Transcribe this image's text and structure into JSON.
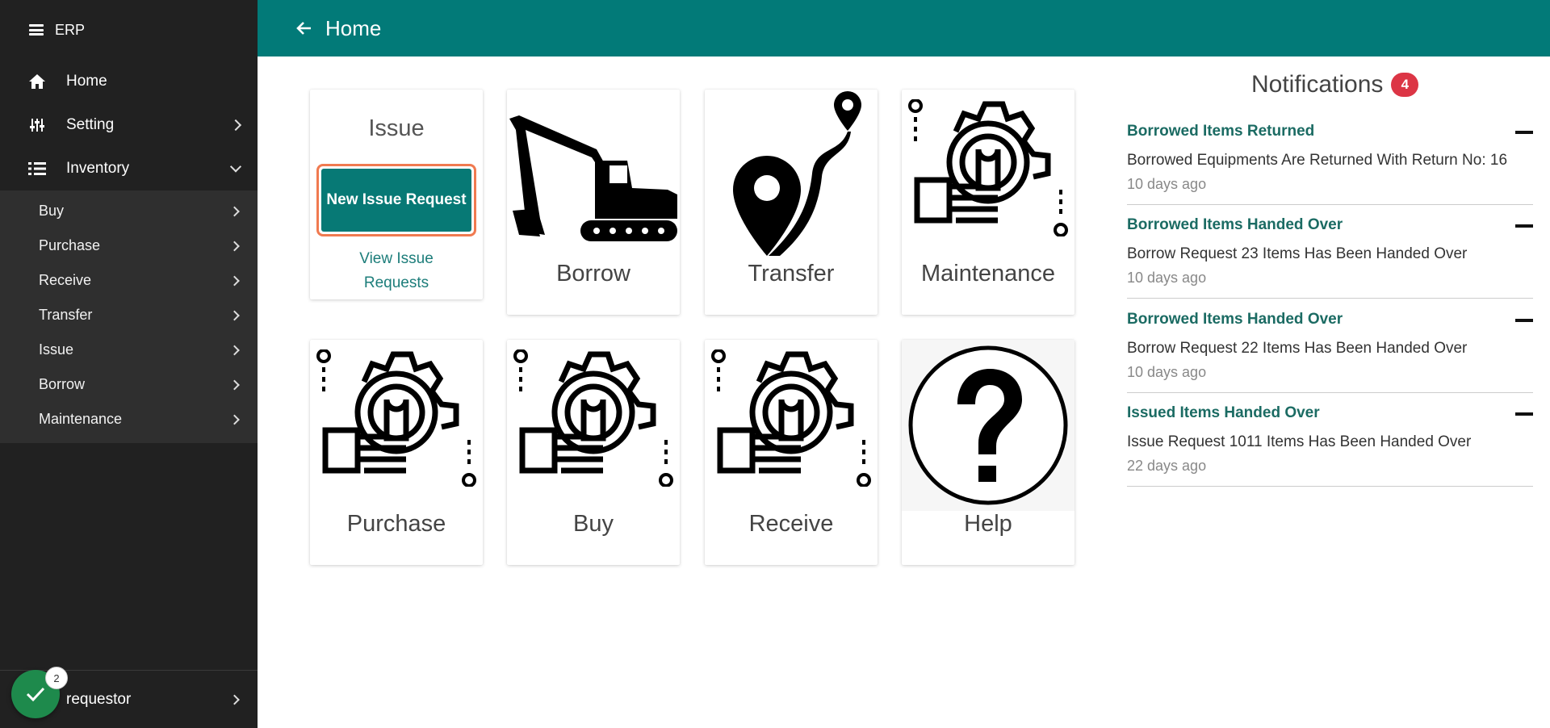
{
  "sidebar": {
    "brand": "ERP",
    "items": [
      {
        "label": "Home",
        "icon": "home-icon"
      },
      {
        "label": "Setting",
        "icon": "sliders-icon"
      },
      {
        "label": "Inventory",
        "icon": "list-icon"
      }
    ],
    "subitems": [
      {
        "label": "Buy"
      },
      {
        "label": "Purchase"
      },
      {
        "label": "Receive"
      },
      {
        "label": "Transfer"
      },
      {
        "label": "Issue"
      },
      {
        "label": "Borrow"
      },
      {
        "label": "Maintenance"
      }
    ],
    "user": "requestor",
    "fab_badge": "2"
  },
  "topbar": {
    "title": "Home"
  },
  "cards": {
    "issue": {
      "title": "Issue",
      "new_button": "New Issue Request",
      "view_link": "View Issue Requests"
    },
    "borrow": {
      "label": "Borrow"
    },
    "transfer": {
      "label": "Transfer"
    },
    "maintenance": {
      "label": "Maintenance"
    },
    "purchase": {
      "label": "Purchase"
    },
    "buy": {
      "label": "Buy"
    },
    "receive": {
      "label": "Receive"
    },
    "help": {
      "label": "Help"
    }
  },
  "notifications": {
    "title": "Notifications",
    "count": "4",
    "items": [
      {
        "title": "Borrowed Items Returned",
        "body": "Borrowed Equipments Are Returned With Return No: 16",
        "time": "10 days ago"
      },
      {
        "title": "Borrowed Items Handed Over",
        "body": "Borrow Request 23 Items Has Been Handed Over",
        "time": "10 days ago"
      },
      {
        "title": "Borrowed Items Handed Over",
        "body": "Borrow Request 22 Items Has Been Handed Over",
        "time": "10 days ago"
      },
      {
        "title": "Issued Items Handed Over",
        "body": "Issue Request 1011 Items Has Been Handed Over",
        "time": "22 days ago"
      }
    ]
  },
  "colors": {
    "topbar": "#027a78",
    "sidebar": "#212121",
    "button": "#077975",
    "accent_border": "#f07a50",
    "badge": "#dc3545"
  }
}
